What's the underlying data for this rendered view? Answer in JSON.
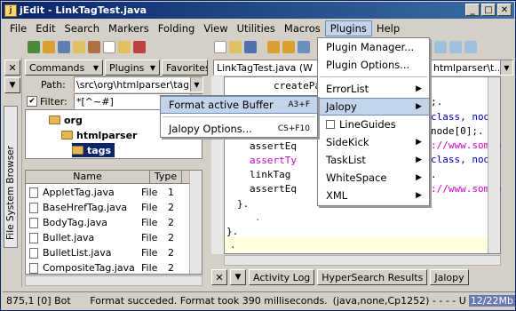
{
  "title": "jEdit - LinkTagTest.java",
  "menubar": [
    "File",
    "Edit",
    "Search",
    "Markers",
    "Folding",
    "View",
    "Utilities",
    "Macros",
    "Plugins",
    "Help"
  ],
  "left": {
    "commands": "Commands",
    "plugins": "Plugins",
    "favorites": "Favorites",
    "path_label": "Path:",
    "path_value": "\\src\\org\\htmlparser\\tags",
    "filter_label": "Filter:",
    "filter_value": "*[^~#]",
    "vtab": "File System Browser",
    "tree": [
      "org",
      "htmlparser",
      "tags"
    ],
    "file_headers": [
      "Name",
      "Type"
    ],
    "files": [
      {
        "name": "AppletTag.java",
        "type": "File",
        "n": "1"
      },
      {
        "name": "BaseHrefTag.java",
        "type": "File",
        "n": "2"
      },
      {
        "name": "BodyTag.java",
        "type": "File",
        "n": "2"
      },
      {
        "name": "Bullet.java",
        "type": "File",
        "n": "2"
      },
      {
        "name": "BulletList.java",
        "type": "File",
        "n": "2"
      },
      {
        "name": "CompositeTag.java",
        "type": "File",
        "n": "2"
      }
    ]
  },
  "editor": {
    "tab": "LinkTagTest.java (W",
    "right_combo": "htmlparser\\t...",
    "lines": [
      "createPa",
      "",
      "",
      "",
      "",
      "assertEq",
      "assertTy",
      "linkTag",
      "assertEq",
      "}.",
      ".",
      "}.",
      "."
    ],
    "right_snippets": [
      ";.",
      "class, node",
      "node[0];.",
      "://www.somep",
      "class, node",
      ".",
      "://www.somep"
    ]
  },
  "popup_menu": {
    "format_label": "Format active Buffer",
    "format_shortcut": "A3+F",
    "options_label": "Jalopy Options...",
    "options_shortcut": "CS+F10"
  },
  "plugins_menu": {
    "items": [
      "Plugin Manager...",
      "Plugin Options...",
      "ErrorList",
      "Jalopy",
      "LineGuides",
      "SideKick",
      "TaskList",
      "WhiteSpace",
      "XML"
    ]
  },
  "bottom_tabs": [
    "Activity Log",
    "HyperSearch Results",
    "Jalopy"
  ],
  "status": {
    "position": "875,1 [0] Bot",
    "message": "Format succeded. Format took 390 milliseconds.",
    "mode": "(java,none,Cp1252) - - - - U",
    "memory": "12/22Mb"
  },
  "colors": {
    "title_bar": "#0a246a",
    "selection": "#0a246a",
    "menu_highlight": "#c3d4ea",
    "keyword_blue": "#0000cc",
    "string_magenta": "#cc00cc"
  }
}
